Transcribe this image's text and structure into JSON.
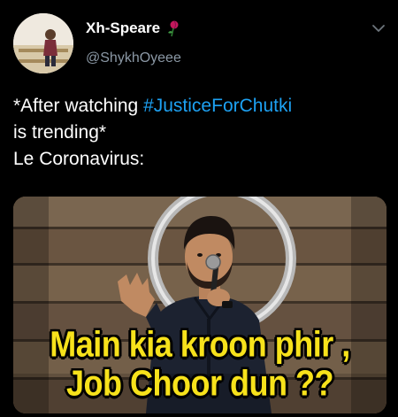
{
  "author": {
    "display_name": "Xh-Speare",
    "name_emoji": "rose-emoji",
    "handle": "@ShykhOyeee",
    "avatar": "avatar-photo"
  },
  "menu_icon": "chevron-down-icon",
  "tweet": {
    "line1_prefix": "*After watching ",
    "hashtag": "#JusticeForChutki",
    "line2": "is trending*",
    "line3": "Le Coronavirus:"
  },
  "meme": {
    "caption_line1": "Main kia kroon phir ,",
    "caption_line2": "Job Choor dun ??"
  },
  "colors": {
    "background": "#000000",
    "text": "#ffffff",
    "secondary_text": "#8b98a5",
    "hashtag": "#1da1f2",
    "caption": "#f7e21b"
  }
}
